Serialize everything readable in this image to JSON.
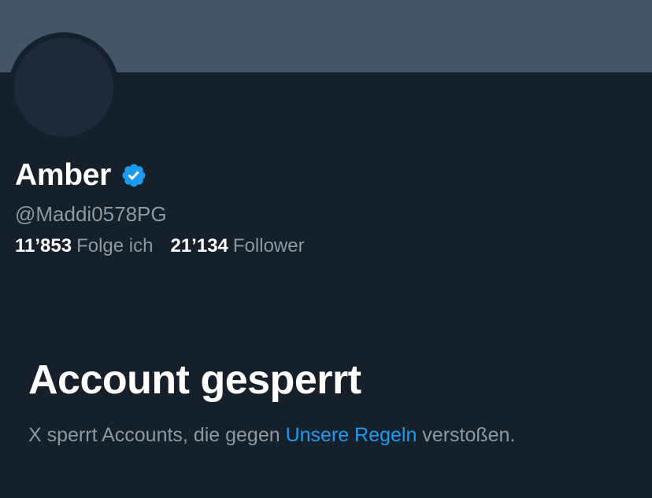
{
  "profile": {
    "display_name": "Amber",
    "handle": "@Maddi0578PG",
    "verified_icon": "verified-badge-icon",
    "verified_color": "#1d9bf0",
    "banner_color": "#425466",
    "following_count": "11’853",
    "following_label": "Folge ich",
    "followers_count": "21’134",
    "followers_label": "Follower"
  },
  "suspension": {
    "title": "Account gesperrt",
    "text_before": "X sperrt Accounts, die gegen ",
    "link_text": "Unsere Regeln",
    "text_after": " verstoßen."
  }
}
